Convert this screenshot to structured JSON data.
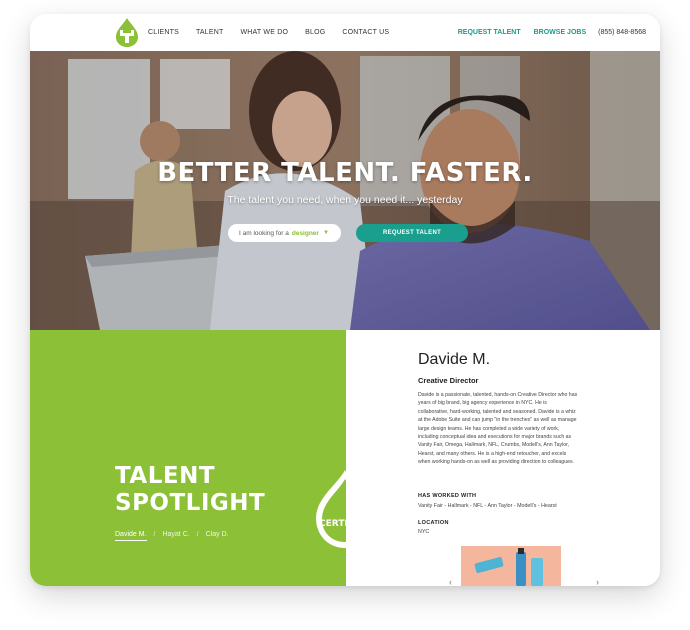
{
  "nav": {
    "links": [
      "CLIENTS",
      "TALENT",
      "WHAT WE DO",
      "BLOG",
      "CONTACT US"
    ],
    "request_talent": "REQUEST TALENT",
    "browse_jobs": "BROWSE JOBS",
    "phone": "(855) 848-8568"
  },
  "hero": {
    "title": "BETTER TALENT. FASTER.",
    "subtitle": "The talent you need, when you need it... yesterday",
    "looking_label": "I am looking for a",
    "looking_value": "designer",
    "cta": "REQUEST TALENT"
  },
  "spotlight": {
    "title_line1": "TALENT",
    "title_line2": "SPOTLIGHT",
    "people": [
      "Davide M.",
      "Hayat C.",
      "Clay D."
    ],
    "certified": "CERTIFIED"
  },
  "profile": {
    "name": "Davide M.",
    "role": "Creative Director",
    "bio": "Davide is a passionate, talented, hands-on Creative Director who has years of big brand, big agency experience in NYC. He is collaborative, hard-working, talented and seasoned. Davide is a whiz at the Adobe Suite and can jump \"in the trenches\" as well as manage large design teams. He has completed a wide variety of work, including conceptual idea and executions for major brands such as Vanity Fair, Omega, Hallmark, NFL, Crumbs, Modell's, Ann Taylor, Hearst, and many others. He is a high-end retoucher, and excels when working hands-on as well as providing direction to colleagues.",
    "worked_heading": "HAS WORKED WITH",
    "worked_with": "Vanity Fair - Hallmark - NFL - Ann Taylor - Modell's - Hearst",
    "location_heading": "LOCATION",
    "location": "NYC"
  },
  "colors": {
    "green": "#8cc036",
    "teal": "#1a9e8e"
  }
}
